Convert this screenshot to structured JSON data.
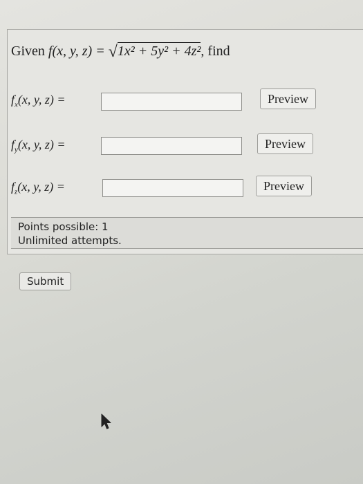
{
  "question": {
    "given_word": "Given",
    "function_lhs": "f(x, y, z) =",
    "radicand": "1x² + 5y² + 4z²",
    "trailing": ", find"
  },
  "rows": [
    {
      "fn": "f",
      "sub": "x",
      "args": "(x, y, z) =",
      "input_value": "",
      "preview_label": "Preview"
    },
    {
      "fn": "f",
      "sub": "y",
      "args": "(x, y, z) =",
      "input_value": "",
      "preview_label": "Preview"
    },
    {
      "fn": "f",
      "sub": "z",
      "args": "(x, y, z) =",
      "input_value": "",
      "preview_label": "Preview"
    }
  ],
  "info": {
    "points": "Points possible: 1",
    "attempts": "Unlimited attempts."
  },
  "submit_label": "Submit",
  "cursor_icon": "arrow-cursor-icon"
}
